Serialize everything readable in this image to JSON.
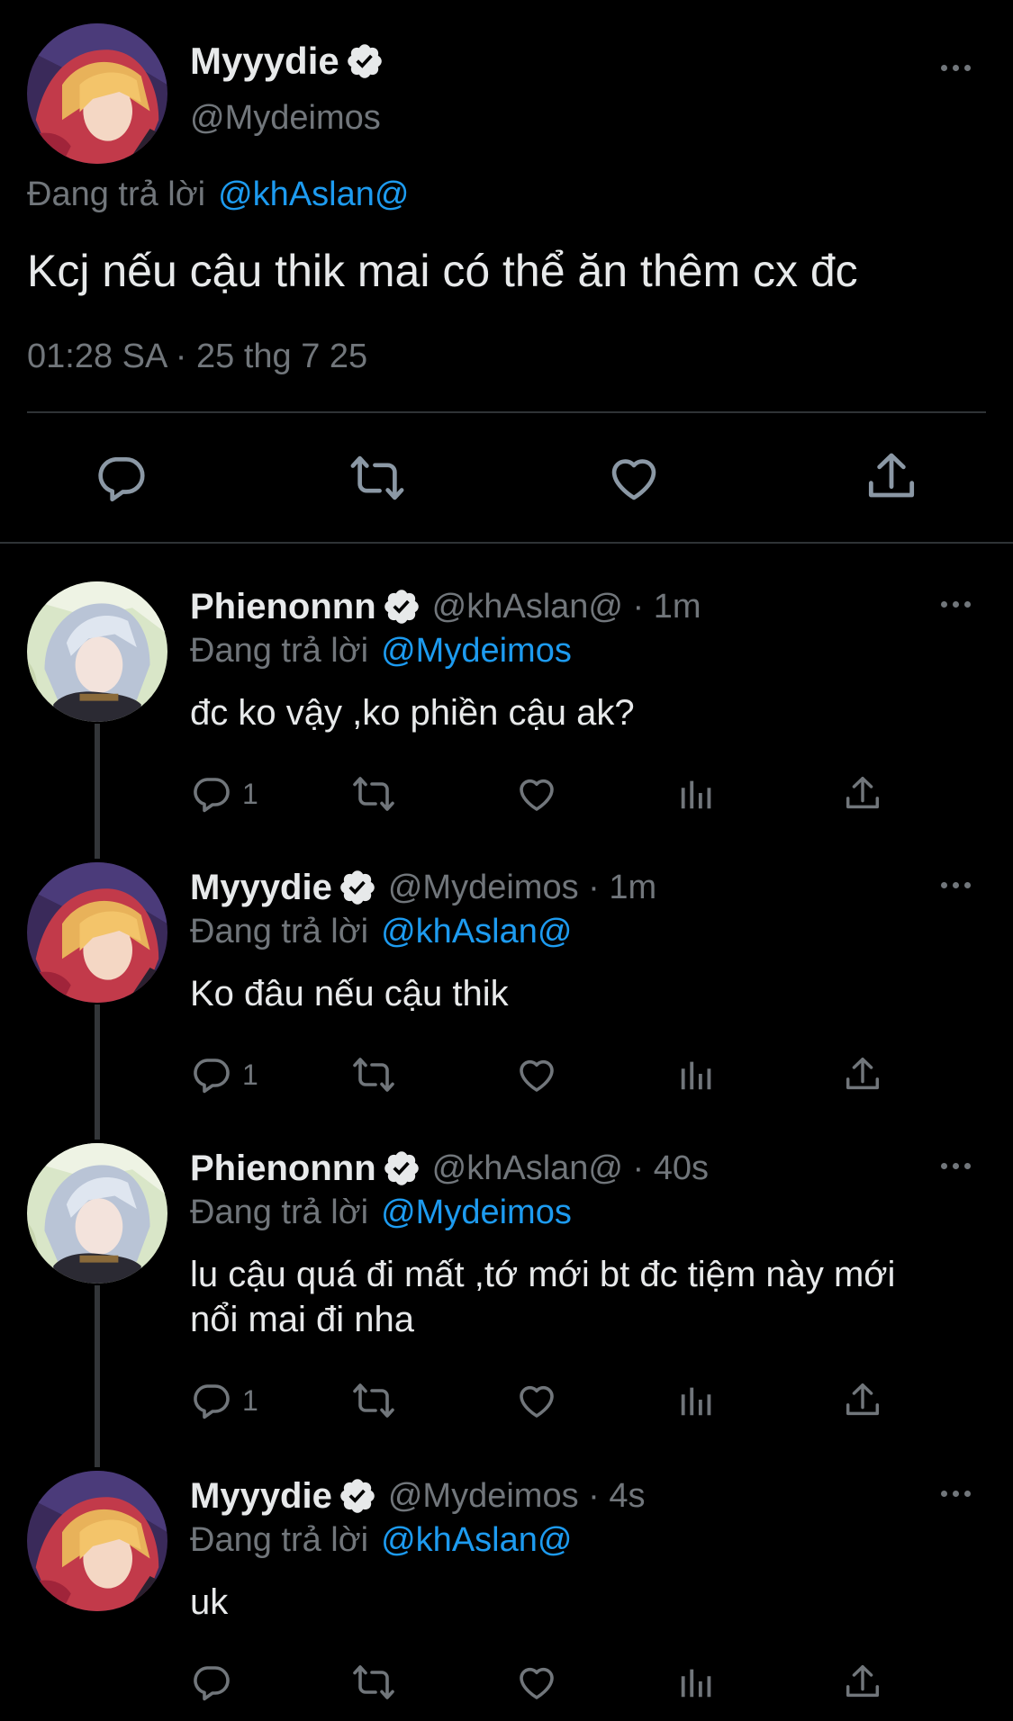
{
  "main_tweet": {
    "display_name": "Myyydie",
    "handle": "@Mydeimos",
    "reply_prefix": "Đang trả lời",
    "reply_to": "@khAslan@",
    "text": "Kcj nếu cậu thik mai có thể ăn thêm cx đc",
    "timestamp": "01:28 SA · 25 thg 7 25"
  },
  "replies": [
    {
      "display_name": "Phienonnn",
      "handle_time": "@khAslan@ · 1m",
      "reply_prefix": "Đang trả lời",
      "reply_to": "@Mydeimos",
      "text": "đc ko vậy ,ko phiền cậu ak?",
      "reply_count": "1"
    },
    {
      "display_name": "Myyydie",
      "handle_time": "@Mydeimos · 1m",
      "reply_prefix": "Đang trả lời",
      "reply_to": "@khAslan@",
      "text": "Ko đâu nếu cậu thik",
      "reply_count": "1"
    },
    {
      "display_name": "Phienonnn",
      "handle_time": "@khAslan@ · 40s",
      "reply_prefix": "Đang trả lời",
      "reply_to": "@Mydeimos",
      "text_line1": "lu cậu quá đi mất ,tớ mới bt đc tiệm này mới",
      "text_line2": "nổi mai đi nha",
      "reply_count": "1"
    },
    {
      "display_name": "Myyydie",
      "handle_time": "@Mydeimos · 4s",
      "reply_prefix": "Đang trả lời",
      "reply_to": "@khAslan@",
      "text": "uk",
      "reply_count": ""
    }
  ],
  "colors": {
    "background": "#000000",
    "text": "#e7e9ea",
    "muted": "#71767b",
    "link": "#1d9bf0",
    "divider": "#2f3336"
  }
}
